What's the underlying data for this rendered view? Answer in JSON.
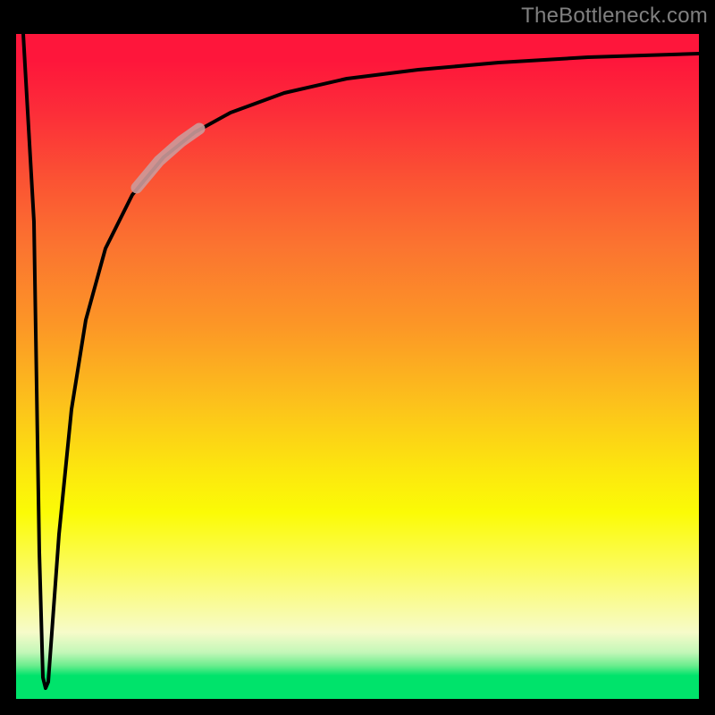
{
  "watermark": "TheBottleneck.com",
  "colors": {
    "frame": "#000000",
    "gradient_top": "#FE163B",
    "gradient_mid1": "#FB7430",
    "gradient_mid2": "#FCE80E",
    "gradient_pale": "#F6FBC9",
    "gradient_green": "#00E36B",
    "curve": "#000000",
    "highlight": "#CC9A9A"
  },
  "chart_data": {
    "type": "line",
    "title": "",
    "xlabel": "",
    "ylabel": "",
    "xlim": [
      0,
      100
    ],
    "ylim": [
      0,
      100
    ],
    "grid": false,
    "series": [
      {
        "name": "curve",
        "x": [
          0,
          2,
          3,
          4,
          5,
          6,
          8,
          10,
          13,
          16,
          20,
          25,
          30,
          35,
          40,
          50,
          60,
          70,
          80,
          90,
          100
        ],
        "y": [
          100,
          70,
          20,
          2,
          10,
          25,
          45,
          58,
          68,
          74,
          79,
          84,
          87,
          89,
          90.5,
          92.5,
          93.8,
          94.7,
          95.3,
          95.8,
          96.2
        ]
      }
    ],
    "annotations": [
      {
        "name": "highlight-segment",
        "x_range": [
          18,
          26
        ],
        "note": "thick pale stroke overlay on curve"
      }
    ]
  }
}
